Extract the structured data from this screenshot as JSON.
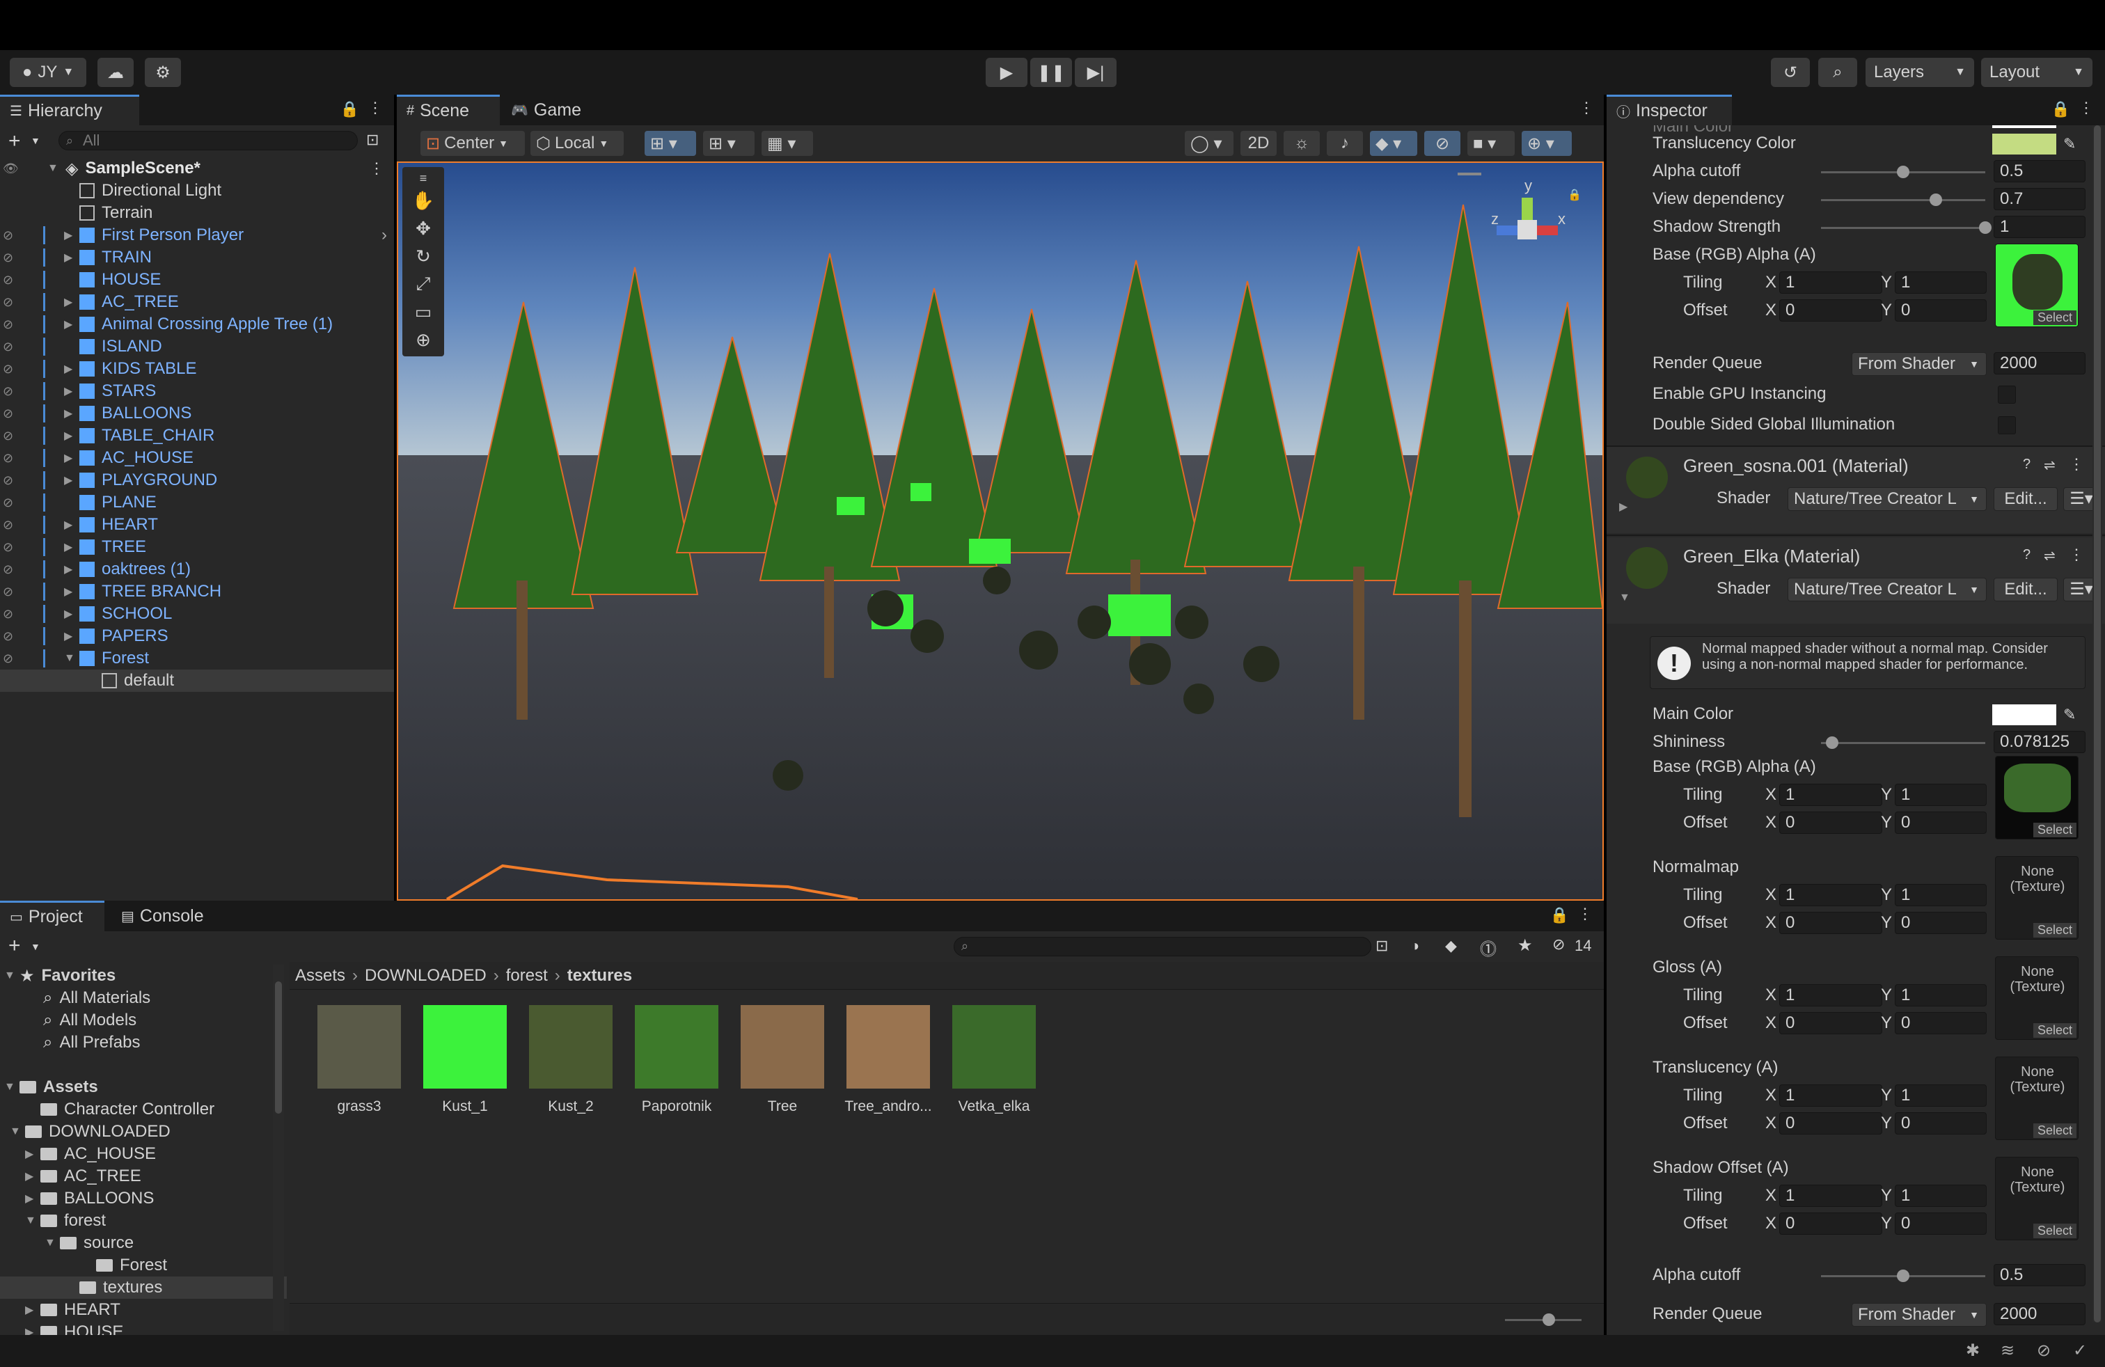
{
  "toolbar": {
    "account": "JY",
    "layers_label": "Layers",
    "layout_label": "Layout"
  },
  "hierarchy": {
    "tab_label": "Hierarchy",
    "search_placeholder": "All",
    "scene_name": "SampleScene*",
    "items": [
      {
        "label": "Directional Light",
        "prefab": false,
        "expander": false
      },
      {
        "label": "Terrain",
        "prefab": false,
        "expander": false
      },
      {
        "label": "First Person Player",
        "prefab": true,
        "expander": true
      },
      {
        "label": "TRAIN",
        "prefab": true,
        "expander": true
      },
      {
        "label": "HOUSE",
        "prefab": true,
        "expander": false
      },
      {
        "label": "AC_TREE",
        "prefab": true,
        "expander": true
      },
      {
        "label": "Animal Crossing Apple Tree (1)",
        "prefab": true,
        "expander": true
      },
      {
        "label": "ISLAND",
        "prefab": true,
        "expander": false
      },
      {
        "label": "KIDS TABLE",
        "prefab": true,
        "expander": true
      },
      {
        "label": "STARS",
        "prefab": true,
        "expander": true
      },
      {
        "label": "BALLOONS",
        "prefab": true,
        "expander": true
      },
      {
        "label": "TABLE_CHAIR",
        "prefab": true,
        "expander": true
      },
      {
        "label": "AC_HOUSE",
        "prefab": true,
        "expander": true
      },
      {
        "label": "PLAYGROUND",
        "prefab": true,
        "expander": true
      },
      {
        "label": "PLANE",
        "prefab": true,
        "expander": false
      },
      {
        "label": "HEART",
        "prefab": true,
        "expander": true
      },
      {
        "label": "TREE",
        "prefab": true,
        "expander": true
      },
      {
        "label": "oaktrees (1)",
        "prefab": true,
        "expander": true
      },
      {
        "label": "TREE BRANCH",
        "prefab": true,
        "expander": true
      },
      {
        "label": "SCHOOL",
        "prefab": true,
        "expander": true
      },
      {
        "label": "PAPERS",
        "prefab": true,
        "expander": true
      },
      {
        "label": "Forest",
        "prefab": true,
        "expander": true
      },
      {
        "label": "default",
        "prefab": false,
        "expander": false
      }
    ]
  },
  "scene": {
    "tab_scene": "Scene",
    "tab_game": "Game",
    "pivot_label": "Center",
    "space_label": "Local",
    "mode_2d": "2D",
    "gizmo_y": "y",
    "gizmo_x": "x",
    "gizmo_z": "z"
  },
  "project": {
    "tab_project": "Project",
    "tab_console": "Console",
    "hidden_count": "14",
    "favorites_label": "Favorites",
    "favorites": [
      "All Materials",
      "All Models",
      "All Prefabs"
    ],
    "assets_label": "Assets",
    "tree": [
      {
        "label": "Character Controller"
      },
      {
        "label": "DOWNLOADED"
      },
      {
        "label": "AC_HOUSE"
      },
      {
        "label": "AC_TREE"
      },
      {
        "label": "BALLOONS"
      },
      {
        "label": "forest"
      },
      {
        "label": "source"
      },
      {
        "label": "Forest"
      },
      {
        "label": "textures"
      },
      {
        "label": "HEART"
      },
      {
        "label": "HOUSE"
      }
    ],
    "breadcrumb": [
      "Assets",
      "DOWNLOADED",
      "forest",
      "textures"
    ],
    "assets": [
      {
        "label": "grass3",
        "color": "#5a5a48"
      },
      {
        "label": "Kust_1",
        "color": "#3cf23c"
      },
      {
        "label": "Kust_2",
        "color": "#4a5a30"
      },
      {
        "label": "Paporotnik",
        "color": "#3d7a2a"
      },
      {
        "label": "Tree",
        "color": "#8a6a4a"
      },
      {
        "label": "Tree_andro...",
        "color": "#9a7450"
      },
      {
        "label": "Vetka_elka",
        "color": "#3a6a2a"
      }
    ]
  },
  "inspector": {
    "tab_label": "Inspector",
    "cut_label": "Main Color",
    "translucency_color_label": "Translucency Color",
    "translucency_color": "#c4dc82",
    "alpha_cutoff_label": "Alpha cutoff",
    "alpha_cutoff_value": "0.5",
    "alpha_cutoff_level": 0.5,
    "view_dependency_label": "View dependency",
    "view_dependency_value": "0.7",
    "view_dependency_level": 0.7,
    "shadow_strength_label": "Shadow Strength",
    "shadow_strength_value": "1",
    "shadow_strength_level": 1,
    "base_label": "Base (RGB) Alpha (A)",
    "tiling_label": "Tiling",
    "offset_label": "Offset",
    "x_label": "X",
    "y_label": "Y",
    "one": "1",
    "zero": "0",
    "select_label": "Select",
    "render_queue_label": "Render Queue",
    "render_queue_dd": "From Shader",
    "render_queue_value": "2000",
    "gpu_instancing_label": "Enable GPU Instancing",
    "double_sided_label": "Double Sided Global Illumination",
    "material1_name": "Green_sosna.001 (Material)",
    "material2_name": "Green_Elka (Material)",
    "shader_label": "Shader",
    "shader_value": "Nature/Tree Creator L",
    "edit_label": "Edit...",
    "warning_text": "Normal mapped shader without a normal map. Consider using a non-normal mapped shader for performance.",
    "main_color_label": "Main Color",
    "main_color": "#ffffff",
    "shininess_label": "Shininess",
    "shininess_value": "0.078125",
    "shininess_level": 0.078125,
    "base2_label": "Base (RGB) Alpha (A)",
    "normalmap_label": "Normalmap",
    "gloss_label": "Gloss (A)",
    "translucency_label": "Translucency (A)",
    "shadow_offset_label": "Shadow Offset (A)",
    "none_texture": "None (Texture)",
    "alpha_cutoff2_label": "Alpha cutoff",
    "alpha_cutoff2_value": "0.5",
    "alpha_cutoff2_level": 0.5,
    "render_queue2_label": "Render Queue",
    "render_queue2_dd": "From Shader",
    "render_queue2_value": "2000"
  }
}
